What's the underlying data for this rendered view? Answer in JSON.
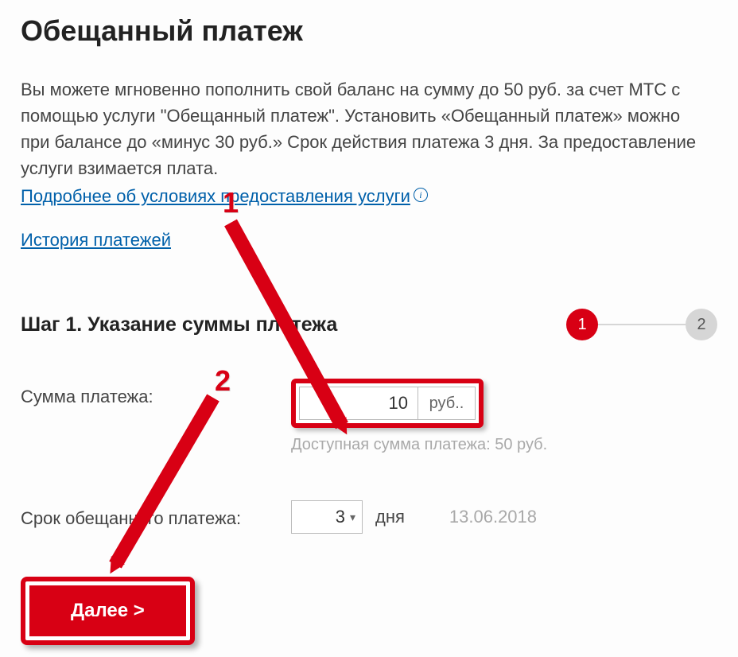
{
  "title": "Обещанный платеж",
  "description": "Вы можете мгновенно пополнить свой баланс на сумму до 50 руб. за счет МТС с помощью услуги \"Обещанный платеж\". Установить «Обещанный платеж» можно при балансе до «минус 30 руб.» Срок действия платежа 3 дня. За предоставление услуги взимается плата.",
  "link_more": "Подробнее об условиях предоставления услуги",
  "link_history": "История платежей",
  "step": {
    "title": "Шаг 1. Указание суммы платежа",
    "active": "1",
    "inactive": "2"
  },
  "form": {
    "amount_label": "Сумма платежа:",
    "amount_value": "10",
    "amount_unit": "руб..",
    "available": "Доступная сумма платежа: 50 руб.",
    "term_label": "Срок обещанного платежа:",
    "term_value": "3",
    "term_unit": "дня",
    "term_date": "13.06.2018"
  },
  "submit_label": "Далее >",
  "annotations": {
    "n1": "1",
    "n2": "2"
  }
}
